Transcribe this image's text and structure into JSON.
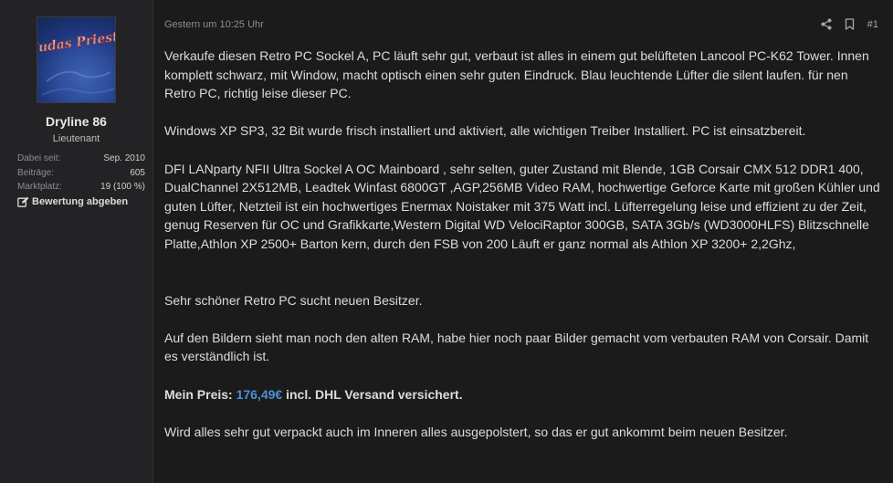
{
  "user": {
    "name": "Dryline 86",
    "title": "Lieutenant",
    "avatar_text": "Judas Priest",
    "stats": [
      {
        "label": "Dabei seit:",
        "value": "Sep. 2010"
      },
      {
        "label": "Beiträge:",
        "value": "605"
      },
      {
        "label": "Marktplatz:",
        "value": "19 (100 %)"
      }
    ],
    "rate_label": "Bewertung abgeben"
  },
  "post": {
    "date": "Gestern um 10:25 Uhr",
    "number": "#1",
    "paragraphs": {
      "p1": "Verkaufe diesen Retro PC Sockel A, PC läuft sehr gut, verbaut ist alles in einem gut belüfteten Lancool PC-K62 Tower. Innen komplett schwarz, mit Window, macht optisch einen sehr guten Eindruck. Blau leuchtende Lüfter die silent laufen. für nen Retro PC, richtig leise dieser PC.",
      "p2": "Windows XP SP3, 32 Bit wurde frisch installiert und aktiviert, alle wichtigen Treiber Installiert. PC ist einsatzbereit.",
      "p3": "DFI LANparty NFII Ultra Sockel A OC Mainboard , sehr selten, guter Zustand mit Blende, 1GB Corsair CMX 512 DDR1 400, DualChannel 2X512MB, Leadtek Winfast 6800GT ,AGP,256MB Video RAM, hochwertige Geforce Karte mit großen Kühler und guten Lüfter, Netzteil ist ein hochwertiges Enermax Noistaker mit 375 Watt incl. Lüfterregelung leise und effizient zu der Zeit, genug Reserven für OC und Grafikkarte,Western Digital WD VelociRaptor 300GB, SATA 3Gb/s (WD3000HLFS) Blitzschnelle Platte,Athlon XP 2500+ Barton kern, durch den FSB von 200 Läuft er ganz normal als Athlon XP 3200+ 2,2Ghz,",
      "p4": "Sehr schöner Retro PC sucht neuen Besitzer.",
      "p5": "Auf den Bildern sieht man noch den alten RAM, habe hier noch paar Bilder gemacht vom verbauten RAM von Corsair. Damit es verständlich ist.",
      "p7": "Wird alles sehr gut verpackt auch im Inneren alles ausgepolstert, so das er gut ankommt beim neuen Besitzer."
    },
    "price": {
      "label": "Mein Preis:",
      "value": "176,49€",
      "suffix": "incl. DHL Versand versichert."
    }
  },
  "colors": {
    "background": "#1b1b1c",
    "sidebar": "#232325",
    "text": "#dcdcdc",
    "price_accent": "#4e8fd6"
  },
  "icons": [
    "share-icon",
    "bookmark-icon",
    "edit-icon"
  ]
}
